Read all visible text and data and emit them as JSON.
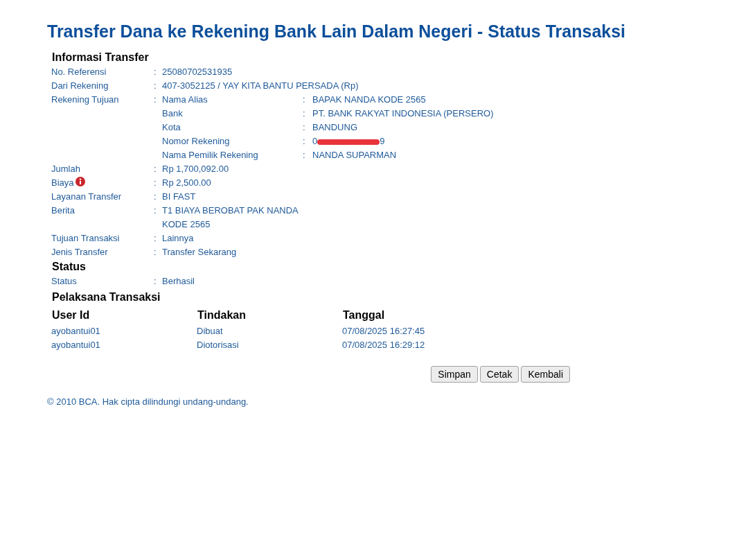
{
  "title": "Transfer Dana ke Rekening Bank Lain Dalam Negeri - Status Transaksi",
  "sections": [
    {
      "heading": "Informasi Transfer",
      "rows": [
        {
          "label": "No. Referensi",
          "sep": ":",
          "value": "25080702531935"
        },
        {
          "label": "Dari Rekening",
          "sep": ":",
          "value": "407-3052125 / YAY KITA BANTU PERSADA  (Rp)"
        },
        {
          "label": "Rekening Tujuan",
          "sep": ":",
          "details": [
            {
              "label": "Nama Alias",
              "sep": ":",
              "value": "BAPAK NANDA KODE 2565"
            },
            {
              "label": "Bank",
              "sep": ":",
              "value": "PT. BANK RAKYAT INDONESIA (PERSERO)"
            },
            {
              "label": "Kota",
              "sep": ":",
              "value": "BANDUNG"
            },
            {
              "label": "Nomor Rekening",
              "sep": ":",
              "value_start": "0",
              "value_end": "9",
              "redacted": true
            },
            {
              "label": "Nama Pemilik Rekening",
              "sep": ":",
              "value": "NANDA SUPARMAN"
            }
          ]
        },
        {
          "label": "Jumlah",
          "sep": ":",
          "value": "Rp 1,700,092.00"
        },
        {
          "label": "Biaya",
          "info": true,
          "sep": ":",
          "value": "Rp 2,500.00"
        },
        {
          "label": "Layanan Transfer",
          "sep": ":",
          "value": "BI FAST"
        },
        {
          "label": "Berita",
          "sep": ":",
          "lines": [
            "T1 BIAYA BEROBAT PAK NANDA",
            "KODE 2565"
          ]
        },
        {
          "label": "Tujuan Transaksi",
          "sep": ":",
          "value": "Lainnya"
        },
        {
          "label": "Jenis Transfer",
          "sep": ":",
          "value": "Transfer Sekarang"
        }
      ]
    },
    {
      "heading": "Status",
      "rows": [
        {
          "label": "Status",
          "sep": ":",
          "value": "Berhasil"
        }
      ]
    }
  ],
  "executors": {
    "heading": "Pelaksana Transaksi",
    "columns": [
      "User Id",
      "Tindakan",
      "Tanggal"
    ],
    "rows": [
      [
        "ayobantui01",
        "Dibuat",
        "07/08/2025 16:27:45"
      ],
      [
        "ayobantui01",
        "Diotorisasi",
        "07/08/2025 16:29:12"
      ]
    ]
  },
  "buttons": [
    "Simpan",
    "Cetak",
    "Kembali"
  ],
  "footer": "© 2010 BCA. Hak cipta dilindungi undang-undang."
}
